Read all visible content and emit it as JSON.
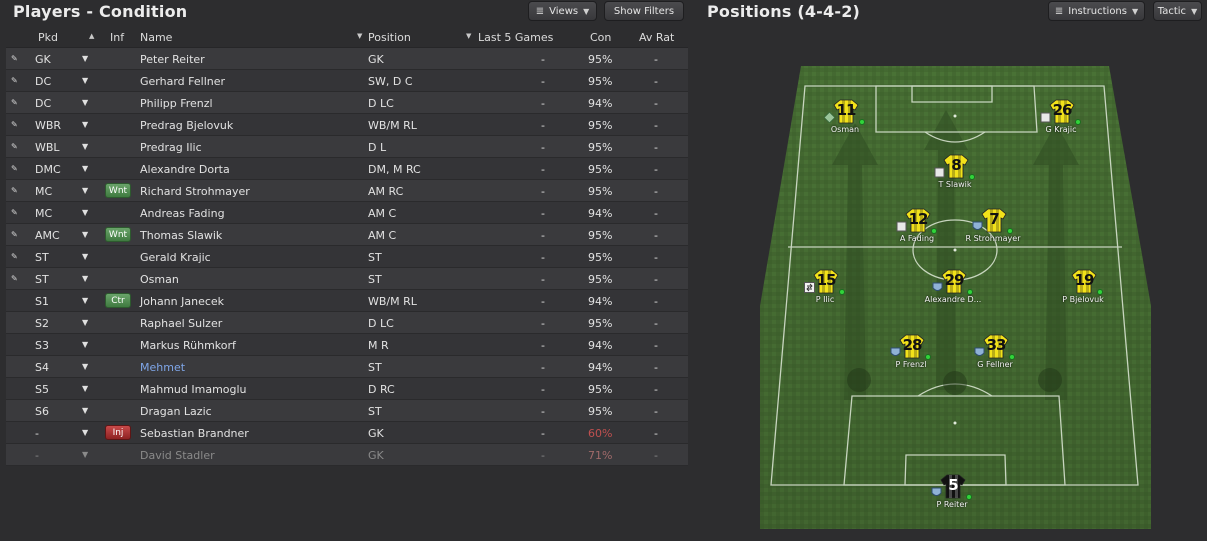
{
  "left": {
    "title": "Players - Condition",
    "views_label": "Views",
    "filters_label": "Show Filters",
    "headers": {
      "pkd": "Pkd",
      "inf": "Inf",
      "name": "Name",
      "position": "Position",
      "last5": "Last 5 Games",
      "con": "Con",
      "avrat": "Av Rat"
    },
    "rows": [
      {
        "pkd": "GK",
        "inf": "",
        "name": "Peter Reiter",
        "position": "GK",
        "last5": "-",
        "con": "95%",
        "avrat": "-"
      },
      {
        "pkd": "DC",
        "inf": "",
        "name": "Gerhard Fellner",
        "position": "SW, D C",
        "last5": "-",
        "con": "95%",
        "avrat": "-"
      },
      {
        "pkd": "DC",
        "inf": "",
        "name": "Philipp Frenzl",
        "position": "D LC",
        "last5": "-",
        "con": "94%",
        "avrat": "-"
      },
      {
        "pkd": "WBR",
        "inf": "",
        "name": "Predrag Bjelovuk",
        "position": "WB/M RL",
        "last5": "-",
        "con": "95%",
        "avrat": "-"
      },
      {
        "pkd": "WBL",
        "inf": "",
        "name": "Predrag Ilic",
        "position": "D L",
        "last5": "-",
        "con": "95%",
        "avrat": "-"
      },
      {
        "pkd": "DMC",
        "inf": "",
        "name": "Alexandre Dorta",
        "position": "DM, M RC",
        "last5": "-",
        "con": "95%",
        "avrat": "-"
      },
      {
        "pkd": "MC",
        "inf": "Wnt",
        "name": "Richard Strohmayer",
        "position": "AM RC",
        "last5": "-",
        "con": "95%",
        "avrat": "-"
      },
      {
        "pkd": "MC",
        "inf": "",
        "name": "Andreas Fading",
        "position": "AM C",
        "last5": "-",
        "con": "94%",
        "avrat": "-"
      },
      {
        "pkd": "AMC",
        "inf": "Wnt",
        "name": "Thomas Slawik",
        "position": "AM C",
        "last5": "-",
        "con": "95%",
        "avrat": "-"
      },
      {
        "pkd": "ST",
        "inf": "",
        "name": "Gerald Krajic",
        "position": "ST",
        "last5": "-",
        "con": "95%",
        "avrat": "-"
      },
      {
        "pkd": "ST",
        "inf": "",
        "name": "Osman",
        "position": "ST",
        "last5": "-",
        "con": "95%",
        "avrat": "-"
      },
      {
        "pkd": "S1",
        "inf": "Ctr",
        "name": "Johann Janecek",
        "position": "WB/M RL",
        "last5": "-",
        "con": "94%",
        "avrat": "-"
      },
      {
        "pkd": "S2",
        "inf": "",
        "name": "Raphael Sulzer",
        "position": "D LC",
        "last5": "-",
        "con": "95%",
        "avrat": "-"
      },
      {
        "pkd": "S3",
        "inf": "",
        "name": "Markus Rühmkorf",
        "position": "M R",
        "last5": "-",
        "con": "94%",
        "avrat": "-"
      },
      {
        "pkd": "S4",
        "inf": "",
        "name": "Mehmet",
        "position": "ST",
        "last5": "-",
        "con": "94%",
        "avrat": "-"
      },
      {
        "pkd": "S5",
        "inf": "",
        "name": "Mahmud Imamoglu",
        "position": "D RC",
        "last5": "-",
        "con": "95%",
        "avrat": "-"
      },
      {
        "pkd": "S6",
        "inf": "",
        "name": "Dragan Lazic",
        "position": "ST",
        "last5": "-",
        "con": "95%",
        "avrat": "-"
      },
      {
        "pkd": "-",
        "inf": "Inj",
        "name": "Sebastian Brandner",
        "position": "GK",
        "last5": "-",
        "con": "60%",
        "avrat": "-"
      },
      {
        "pkd": "-",
        "inf": "",
        "name": "David Stadler",
        "position": "GK",
        "last5": "-",
        "con": "71%",
        "avrat": "-"
      }
    ]
  },
  "right": {
    "title": "Positions (4-4-2)",
    "instructions_label": "Instructions",
    "tactic_label": "Tactic",
    "players": [
      {
        "num": "11",
        "name": "Osman"
      },
      {
        "num": "26",
        "name": "G Krajic"
      },
      {
        "num": "8",
        "name": "T Slawik"
      },
      {
        "num": "12",
        "name": "A Fading"
      },
      {
        "num": "7",
        "name": "R Strohmayer"
      },
      {
        "num": "15",
        "name": "P Ilic"
      },
      {
        "num": "29",
        "name": "Alexandre D..."
      },
      {
        "num": "19",
        "name": "P Bjelovuk"
      },
      {
        "num": "28",
        "name": "P Frenzl"
      },
      {
        "num": "33",
        "name": "G Fellner"
      },
      {
        "num": "5",
        "name": "P Reiter"
      }
    ]
  },
  "colors": {
    "background": "#2d2d2f",
    "pitch_dark": "#3d6a2c",
    "pitch_light": "#4e7d37",
    "shirt_yellow": "#f2e21a",
    "wanted_badge": "#4f8d50",
    "injury_badge": "#b03333",
    "low_condition": "#c05050"
  }
}
